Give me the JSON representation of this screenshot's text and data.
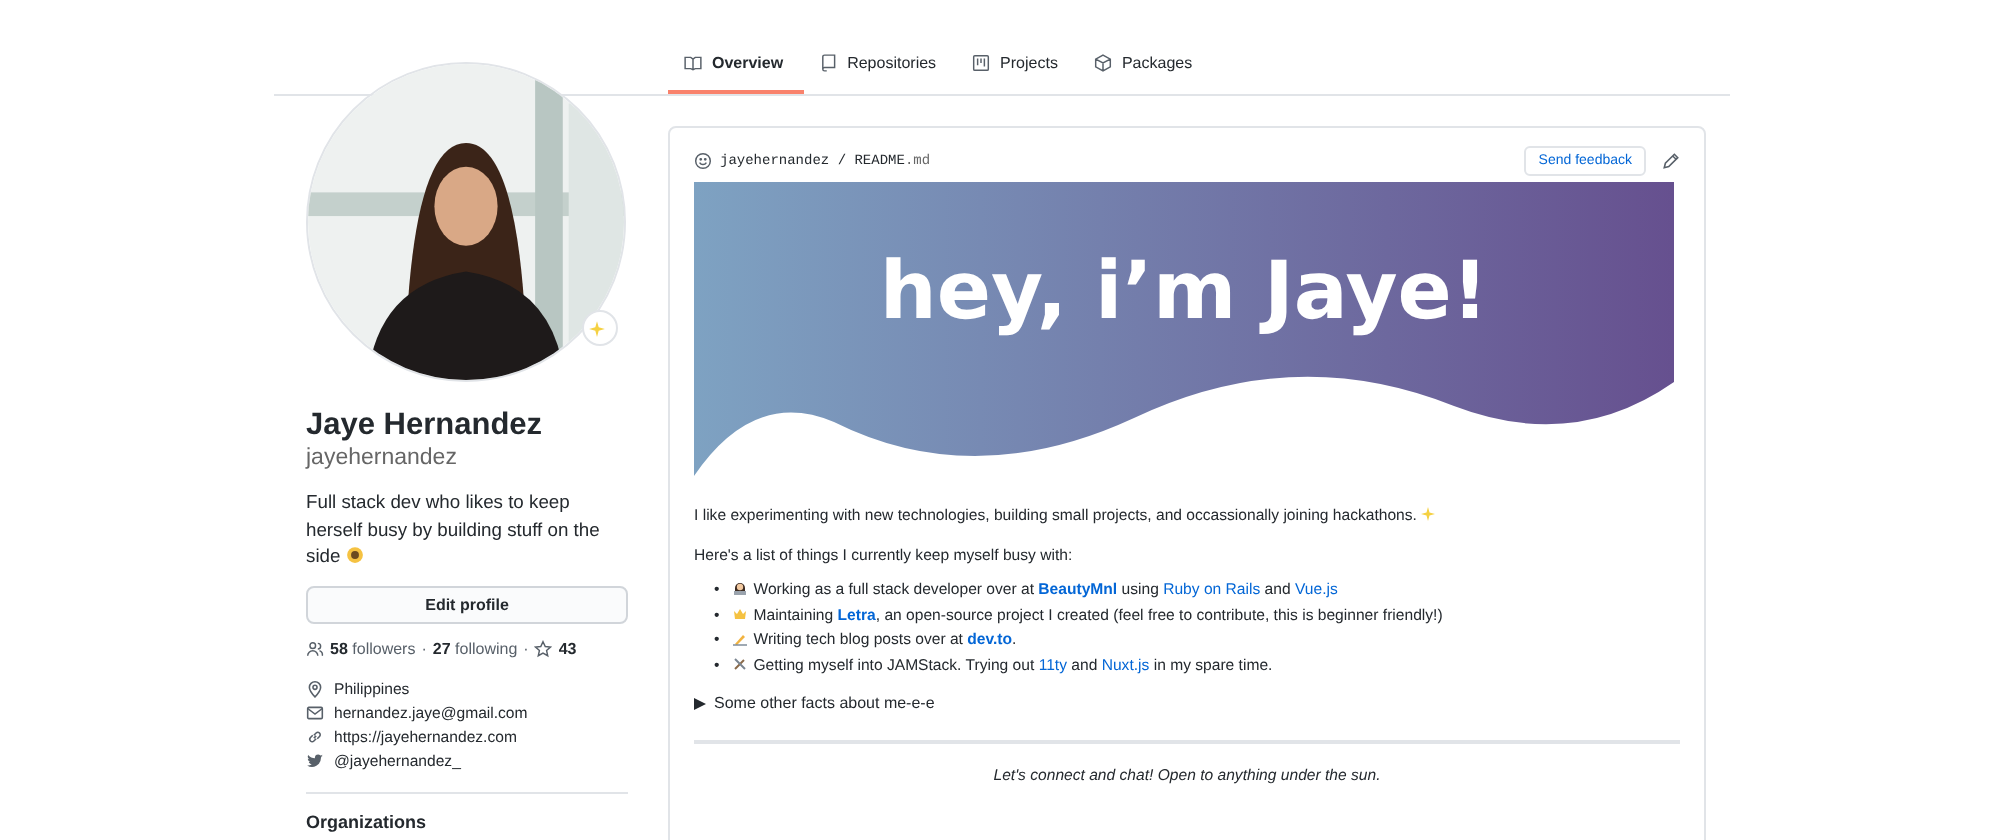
{
  "profile": {
    "name": "Jaye Hernandez",
    "username": "jayehernandez",
    "bio": "Full stack dev who likes to keep herself busy by building stuff on the side",
    "edit_button": "Edit profile",
    "stats": [
      {
        "count": "58",
        "label": "followers",
        "separator": "·"
      },
      {
        "count": "27",
        "label": "following",
        "separator": "·"
      }
    ],
    "stars": "43",
    "contacts": [
      {
        "kind": "location",
        "text": "Philippines"
      },
      {
        "kind": "email",
        "text": "hernandez.jaye@gmail.com"
      },
      {
        "kind": "link",
        "text": "https://jayehernandez.com"
      },
      {
        "kind": "twitter",
        "text": "@jayehernandez_"
      }
    ],
    "organizations_heading": "Organizations"
  },
  "tabs": [
    {
      "label": "Overview",
      "kind": "book",
      "selected": true
    },
    {
      "label": "Repositories",
      "kind": "repo",
      "selected": false
    },
    {
      "label": "Projects",
      "kind": "project",
      "selected": false
    },
    {
      "label": "Packages",
      "kind": "package",
      "selected": false
    }
  ],
  "readme": {
    "owner": "jayehernandez",
    "separator": "/",
    "file": "README",
    "ext": ".md",
    "feedback_button": "Send feedback",
    "banner_title": "hey, i’m Jaye!",
    "intro": "I like experimenting with new technologies, building small projects, and occassionally joining hackathons.",
    "list_heading": "Here's a list of things I currently keep myself busy with:",
    "items": [
      {
        "bullet": "•",
        "parts": [
          {
            "kind": "text",
            "text": "Working as a full stack developer over at "
          },
          {
            "kind": "strong-link",
            "text": "BeautyMnl"
          },
          {
            "kind": "text",
            "text": " using "
          },
          {
            "kind": "link",
            "text": "Ruby on Rails"
          },
          {
            "kind": "text",
            "text": " and "
          },
          {
            "kind": "link",
            "text": "Vue.js"
          }
        ]
      },
      {
        "bullet": "•",
        "parts": [
          {
            "kind": "text",
            "text": "Maintaining "
          },
          {
            "kind": "strong-link",
            "text": "Letra"
          },
          {
            "kind": "text",
            "text": ", an open-source project I created (feel free to contribute, this is beginner friendly!)"
          }
        ]
      },
      {
        "bullet": "•",
        "parts": [
          {
            "kind": "text",
            "text": "Writing tech blog posts over at "
          },
          {
            "kind": "strong-link",
            "text": "dev.to"
          },
          {
            "kind": "text",
            "text": "."
          }
        ]
      },
      {
        "bullet": "•",
        "parts": [
          {
            "kind": "text",
            "text": "Getting myself into JAMStack. Trying out "
          },
          {
            "kind": "link",
            "text": "11ty"
          },
          {
            "kind": "text",
            "text": " and "
          },
          {
            "kind": "link",
            "text": "Nuxt.js"
          },
          {
            "kind": "text",
            "text": " in my spare time."
          }
        ]
      }
    ],
    "details_summary": "Some other facts about me-e-e",
    "details_expanded": false,
    "footer": "Let's connect and chat! Open to anything under the sun."
  }
}
